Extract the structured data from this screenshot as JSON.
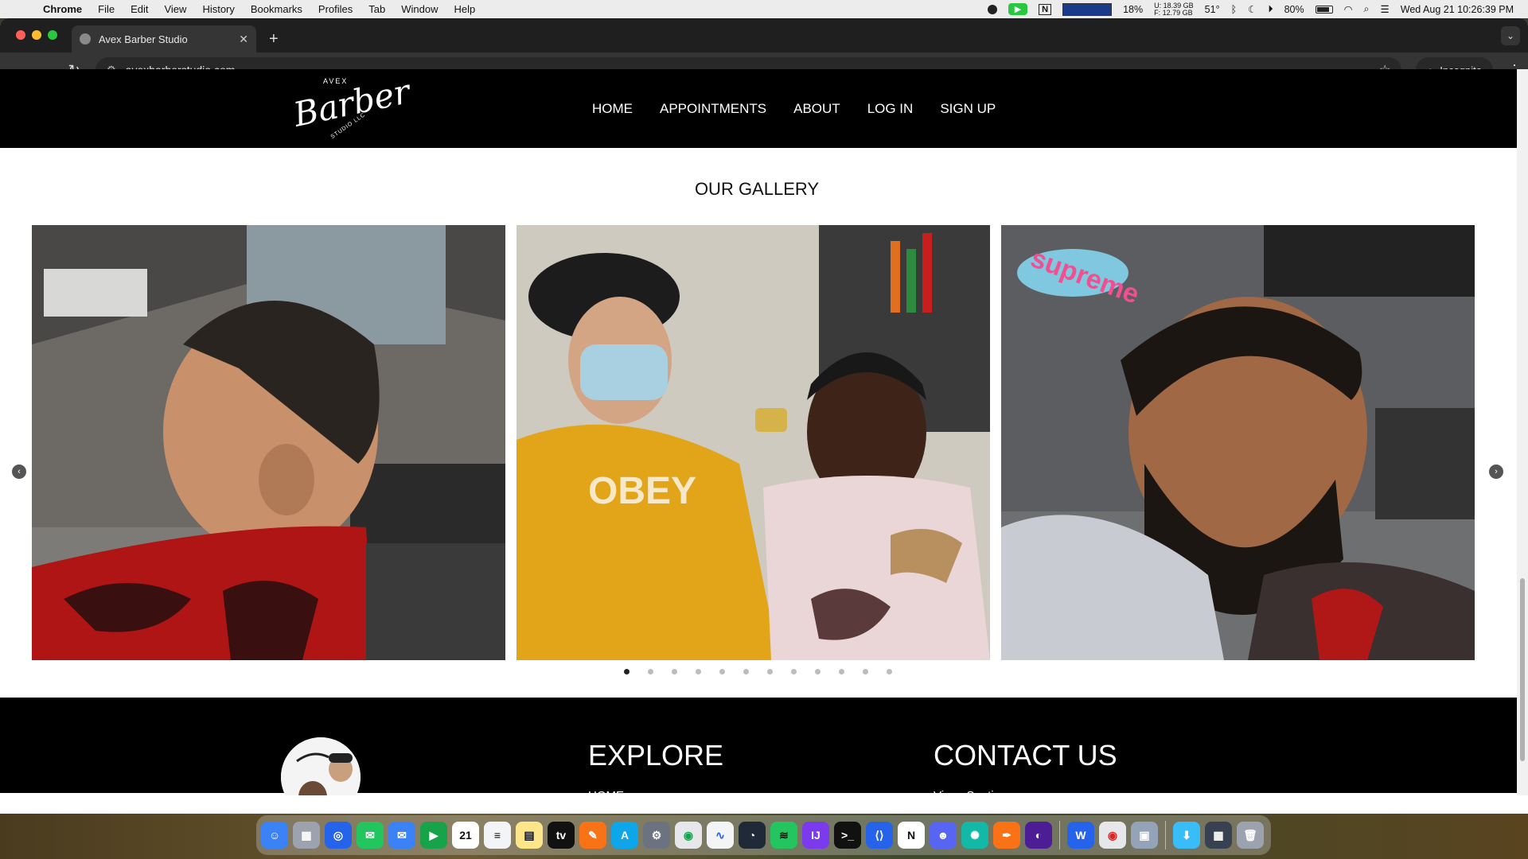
{
  "menubar": {
    "app": "Chrome",
    "items": [
      "File",
      "Edit",
      "View",
      "History",
      "Bookmarks",
      "Profiles",
      "Tab",
      "Window",
      "Help"
    ],
    "cpu": "18%",
    "mem_u": "U: 18.39 GB",
    "mem_f": "F: 12.79 GB",
    "temp": "51°",
    "battery": "80%",
    "datetime": "Wed Aug 21  10:26:39 PM"
  },
  "browser": {
    "tab_title": "Avex Barber Studio",
    "url": "avexbarberstudio.com",
    "incognito_label": "Incognito"
  },
  "site": {
    "logo": {
      "top": "AVEX",
      "main": "Barber",
      "bottom": "STUDIO LLC"
    },
    "nav": [
      "HOME",
      "APPOINTMENTS",
      "ABOUT",
      "LOG IN",
      "SIGN UP"
    ],
    "gallery_title": "OUR GALLERY",
    "slide_count": 12,
    "active_slide": 1,
    "footer": {
      "explore": "EXPLORE",
      "contact": "CONTACT US",
      "explore_first": "HOME",
      "contact_first": "Vinny Santiago"
    }
  },
  "colors": {
    "header_bg": "#000000",
    "page_bg": "#ffffff",
    "facetime_green": "#28c840"
  }
}
